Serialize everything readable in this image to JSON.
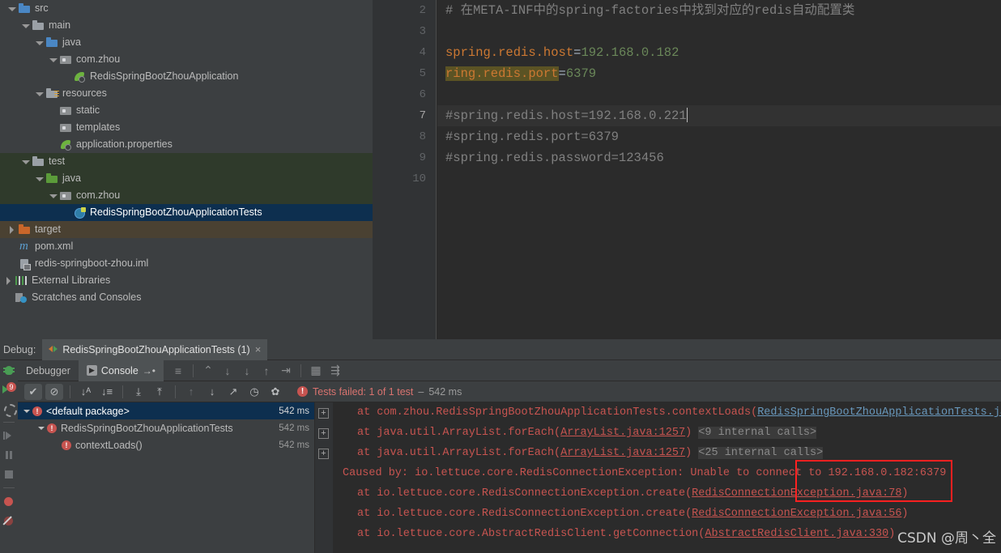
{
  "project_tree": [
    {
      "label": "src",
      "indent": 0,
      "arrow": "down",
      "icon": "folder-src",
      "row": "plain"
    },
    {
      "label": "main",
      "indent": 1,
      "arrow": "down",
      "icon": "folder",
      "row": "plain"
    },
    {
      "label": "java",
      "indent": 2,
      "arrow": "down",
      "icon": "folder-src",
      "row": "plain"
    },
    {
      "label": "com.zhou",
      "indent": 3,
      "arrow": "down",
      "icon": "pkg",
      "row": "plain"
    },
    {
      "label": "RedisSpringBootZhouApplication",
      "indent": 4,
      "arrow": "none",
      "icon": "spring",
      "row": "plain"
    },
    {
      "label": "resources",
      "indent": 2,
      "arrow": "down",
      "icon": "folder-res",
      "row": "plain"
    },
    {
      "label": "static",
      "indent": 3,
      "arrow": "none",
      "icon": "pkg",
      "row": "plain"
    },
    {
      "label": "templates",
      "indent": 3,
      "arrow": "none",
      "icon": "pkg",
      "row": "plain"
    },
    {
      "label": "application.properties",
      "indent": 3,
      "arrow": "none",
      "icon": "spring",
      "row": "plain"
    },
    {
      "label": "test",
      "indent": 1,
      "arrow": "down",
      "icon": "folder",
      "row": "src-test"
    },
    {
      "label": "java",
      "indent": 2,
      "arrow": "down",
      "icon": "folder-test",
      "row": "src-test"
    },
    {
      "label": "com.zhou",
      "indent": 3,
      "arrow": "down",
      "icon": "pkg",
      "row": "src-test"
    },
    {
      "label": "RedisSpringBootZhouApplicationTests",
      "indent": 4,
      "arrow": "none",
      "icon": "cls-test",
      "row": "selected"
    },
    {
      "label": "target",
      "indent": 0,
      "arrow": "right",
      "icon": "folder-target",
      "row": "src-target"
    },
    {
      "label": "pom.xml",
      "indent": 0,
      "arrow": "none",
      "icon": "maven",
      "row": "plain"
    },
    {
      "label": "redis-springboot-zhou.iml",
      "indent": 0,
      "arrow": "none",
      "icon": "iml",
      "row": "plain"
    },
    {
      "label": "External Libraries",
      "indent": -1,
      "arrow": "right",
      "icon": "libs",
      "row": "plain"
    },
    {
      "label": "Scratches and Consoles",
      "indent": -1,
      "arrow": "none",
      "icon": "scratch",
      "row": "plain"
    }
  ],
  "editor": {
    "first_visible_line": 2,
    "caret_line": 7,
    "lines": [
      {
        "num": 2,
        "type": "comment",
        "text": "# 在META-INF中的spring-factories中找到对应的redis自动配置类"
      },
      {
        "num": 3,
        "type": "empty",
        "text": ""
      },
      {
        "num": 4,
        "type": "prop",
        "key": "spring.redis.host",
        "eq": "=",
        "value": "192.168.0.182",
        "highlight": false
      },
      {
        "num": 5,
        "type": "prop",
        "key": "ring.redis.port",
        "eq": "=",
        "value": "6379",
        "highlight": true
      },
      {
        "num": 6,
        "type": "empty",
        "text": ""
      },
      {
        "num": 7,
        "type": "comment",
        "text": "#spring.redis.host=192.168.0.221",
        "caret": true
      },
      {
        "num": 8,
        "type": "comment",
        "text": "#spring.redis.port=6379"
      },
      {
        "num": 9,
        "type": "comment",
        "text": "#spring.redis.password=123456"
      },
      {
        "num": 10,
        "type": "empty",
        "text": ""
      }
    ]
  },
  "debug": {
    "panel_label": "Debug:",
    "run_tab_label": "RedisSpringBootZhouApplicationTests (1)",
    "close_glyph": "×",
    "subtabs": [
      {
        "label": "Debugger",
        "active": false
      },
      {
        "label": "Console",
        "active": true
      }
    ],
    "console_glyph": "▶",
    "pin_glyph": "→•",
    "left_gutter_icons": [
      "bug-icon",
      "rerun-with-count-icon",
      "restart-icon",
      "resume-program-icon",
      "pause-program-icon",
      "stop-icon",
      "view-breakpoints-icon",
      "mute-breakpoints-icon"
    ],
    "console_toolbar_icons": [
      "soft-wrap-icon",
      "scroll-up-icon",
      "scroll-to-end-icon",
      "print-icon",
      "export-icon",
      "close-on-exit-icon",
      "table-icon",
      "settings-list-icon"
    ],
    "test_toolbar_icons": [
      "show-passed-icon",
      "hide-ignored-icon",
      "sort-alphabetically-icon",
      "sort-by-duration-icon",
      "expand-all-icon",
      "collapse-all-icon",
      "prev-failed-icon",
      "next-failed-icon",
      "export-test-results-icon",
      "history-icon",
      "settings-icon"
    ],
    "status": {
      "badge": "!",
      "failed_text": "Tests failed: 1 of 1 test",
      "dash": "–",
      "duration": "542 ms"
    },
    "test_tree": [
      {
        "label": "<default package>",
        "time": "542 ms",
        "indent": 0,
        "arrow": "down",
        "selected": true
      },
      {
        "label": "RedisSpringBootZhouApplicationTests",
        "time": "542 ms",
        "indent": 1,
        "arrow": "down",
        "selected": false
      },
      {
        "label": "contextLoads()",
        "time": "542 ms",
        "indent": 2,
        "arrow": "none",
        "selected": false
      }
    ],
    "fold_marker": "+",
    "console_output": [
      {
        "indent": true,
        "pre": "at com.zhou.RedisSpringBootZhouApplicationTests.contextLoads(",
        "link": "RedisSpringBootZhouApplicationTests.jav",
        "post": "",
        "link_color": "blue"
      },
      {
        "indent": true,
        "pre": "at java.util.ArrayList.forEach(",
        "link": "ArrayList.java:1257",
        "post": ") ",
        "internal": "<9 internal calls>",
        "link_color": "red"
      },
      {
        "indent": true,
        "pre": "at java.util.ArrayList.forEach(",
        "link": "ArrayList.java:1257",
        "post": ") ",
        "internal": "<25 internal calls>",
        "link_color": "red"
      },
      {
        "indent": false,
        "pre": "Caused by: io.lettuce.core.RedisConnectionException: Unable to connect to 192.168.0.182:6379",
        "link": "",
        "post": "",
        "link_color": "red"
      },
      {
        "indent": true,
        "pre": "at io.lettuce.core.RedisConnectionException.create(",
        "link": "RedisConnectionException.java:78",
        "post": ")",
        "link_color": "red"
      },
      {
        "indent": true,
        "pre": "at io.lettuce.core.RedisConnectionException.create(",
        "link": "RedisConnectionException.java:56",
        "post": ")",
        "link_color": "red"
      },
      {
        "indent": true,
        "pre": "at io.lettuce.core.AbstractRedisClient.getConnection(",
        "link": "AbstractRedisClient.java:330",
        "post": ")",
        "link_color": "red"
      }
    ]
  },
  "annotation": {
    "red_box_target": "192.168.0.182:6379"
  },
  "watermark": "CSDN @周丶全"
}
